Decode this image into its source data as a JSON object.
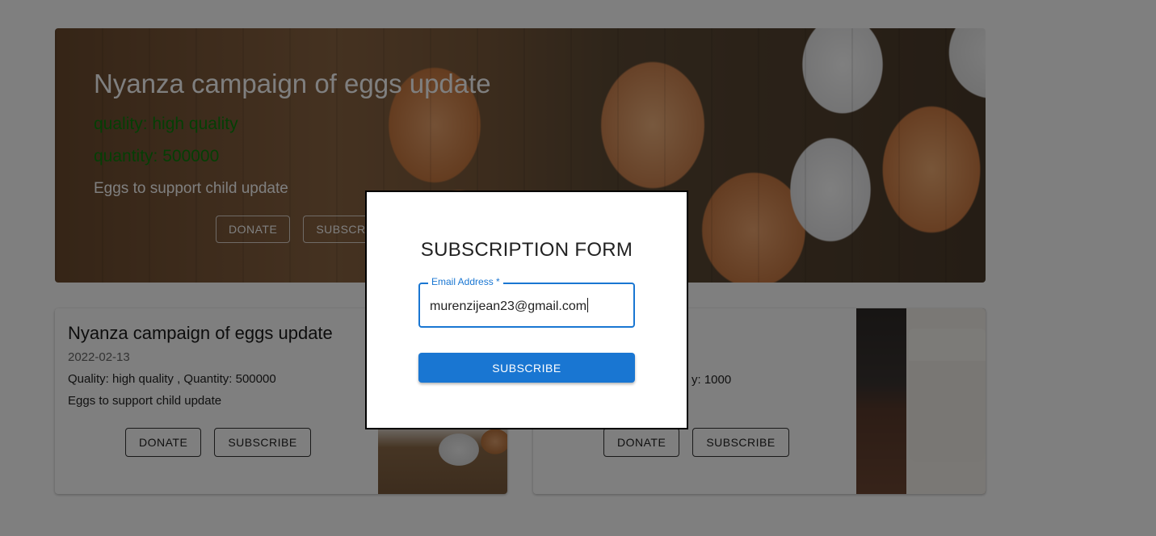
{
  "hero": {
    "title": "Nyanza campaign of eggs update",
    "quality": "quality: high quality",
    "quantity": "quantity: 500000",
    "description": "Eggs to support child update",
    "donate_label": "DONATE",
    "subscribe_label": "SUBSCRIBE"
  },
  "cards": [
    {
      "title": "Nyanza campaign of eggs update",
      "date": "2022-02-13",
      "quality_quantity": "Quality: high quality , Quantity: 500000",
      "description": "Eggs to support child update",
      "donate_label": "DONATE",
      "subscribe_label": "SUBSCRIBE"
    },
    {
      "visible_fragment": "y: 1000",
      "donate_label": "DONATE",
      "subscribe_label": "SUBSCRIBE"
    }
  ],
  "dialog": {
    "title": "SUBSCRIPTION FORM",
    "email_label": "Email Address *",
    "email_value": "murenzijean23@gmail.com",
    "submit_label": "SUBSCRIBE"
  },
  "colors": {
    "accent": "#1976d2",
    "quality_green": "#0a7f0a",
    "backdrop": "rgba(0,0,0,0.5)"
  }
}
